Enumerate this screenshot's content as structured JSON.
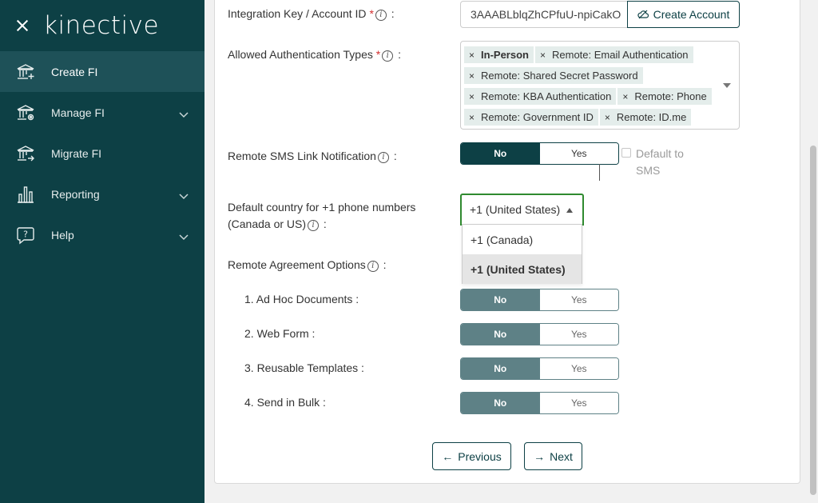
{
  "sidebar": {
    "logo": "kinective",
    "items": [
      {
        "label": "Create FI",
        "icon": "bank-plus-icon",
        "active": true,
        "expandable": false
      },
      {
        "label": "Manage FI",
        "icon": "bank-gear-icon",
        "active": false,
        "expandable": true
      },
      {
        "label": "Migrate FI",
        "icon": "bank-arrow-icon",
        "active": false,
        "expandable": false
      },
      {
        "label": "Reporting",
        "icon": "bar-chart-icon",
        "active": false,
        "expandable": true
      },
      {
        "label": "Help",
        "icon": "help-bubble-icon",
        "active": false,
        "expandable": true
      }
    ]
  },
  "form": {
    "integration_key": {
      "label": "Integration Key / Account ID",
      "required_mark": "*",
      "value": "3AAABLblqZhCPfuU-npiCakO",
      "button": "Create Account"
    },
    "auth_types": {
      "label": "Allowed Authentication Types",
      "required_mark": "*",
      "chips": [
        "In-Person",
        "Remote: Email Authentication",
        "Remote: Shared Secret Password",
        "Remote: KBA Authentication",
        "Remote: Phone",
        "Remote: Government ID",
        "Remote: ID.me"
      ]
    },
    "sms": {
      "label": "Remote SMS Link Notification",
      "no": "No",
      "yes": "Yes",
      "default_label": "Default to SMS"
    },
    "country": {
      "label": "Default country for +1 phone numbers (Canada or US)",
      "selected": "+1 (United States)",
      "options": [
        "+1 (Canada)",
        "+1 (United States)"
      ]
    },
    "agreement": {
      "label": "Remote Agreement Options",
      "options": [
        {
          "label": "1. Ad Hoc Documents :",
          "no": "No",
          "yes": "Yes"
        },
        {
          "label": "2. Web Form :",
          "no": "No",
          "yes": "Yes"
        },
        {
          "label": "3. Reusable Templates :",
          "no": "No",
          "yes": "Yes"
        },
        {
          "label": "4. Send in Bulk :",
          "no": "No",
          "yes": "Yes"
        }
      ]
    }
  },
  "nav": {
    "previous": "Previous",
    "previous_arrow": "←",
    "next": "Next",
    "next_arrow": "→"
  },
  "colors": {
    "sidebar_bg": "#0d4045",
    "sidebar_active": "#1e5158",
    "primary": "#0d4045",
    "muted_toggle": "#5e8186",
    "chip_bg": "#e4edeb",
    "select_focus": "#2f8a2f",
    "required": "#d32f2f"
  }
}
